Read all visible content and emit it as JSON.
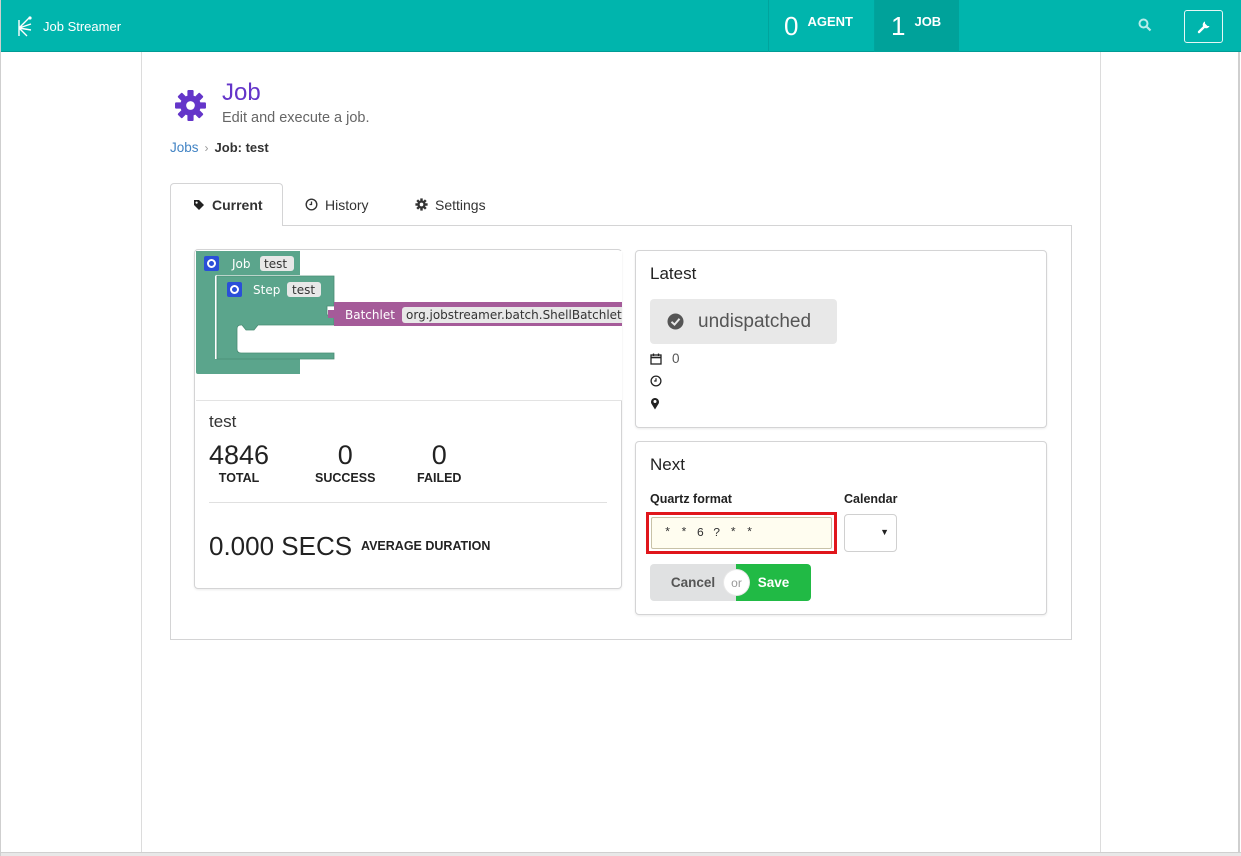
{
  "navbar": {
    "app_name": "Job Streamer",
    "agent_count": "0",
    "agent_label": "AGENT",
    "job_count": "1",
    "job_label": "JOB",
    "icons": [
      "logo-icon",
      "search-icon",
      "wrench-icon"
    ],
    "color": "#00b5ad"
  },
  "header": {
    "title": "Job",
    "subtitle": "Edit and execute a job.",
    "icon": "gear-icon",
    "color": "#6435c9"
  },
  "breadcrumb": {
    "root": "Jobs",
    "current": "Job: test"
  },
  "tabs": [
    {
      "label": "Current",
      "icon": "tag-icon",
      "active": true
    },
    {
      "label": "History",
      "icon": "clock-icon",
      "active": false
    },
    {
      "label": "Settings",
      "icon": "gear-icon",
      "active": false
    }
  ],
  "blocks": {
    "job_label": "Job",
    "job_value": "test",
    "step_label": "Step",
    "step_value": "test",
    "batchlet_label": "Batchlet",
    "batchlet_value": "org.jobstreamer.batch.ShellBatchlet",
    "colors": {
      "job": "#5ba58c",
      "batchlet": "#a55b99"
    }
  },
  "summary": {
    "job_name": "test",
    "total_value": "4846",
    "total_label": "TOTAL",
    "success_value": "0",
    "success_label": "SUCCESS",
    "failed_value": "0",
    "failed_label": "FAILED",
    "avg_value": "0.000 SECS",
    "avg_label": "AVERAGE DURATION"
  },
  "latest": {
    "title": "Latest",
    "status": "undispatched",
    "status_icon": "check-circle-icon",
    "date_value": "0",
    "icons": [
      "calendar-icon",
      "clock-icon",
      "map-marker-icon"
    ]
  },
  "next": {
    "title": "Next",
    "quartz_label": "Quartz format",
    "quartz_value": "* * 6 ? * *",
    "calendar_label": "Calendar",
    "calendar_value": "",
    "cancel_label": "Cancel",
    "or_label": "or",
    "save_label": "Save",
    "save_color": "#21ba45",
    "highlight_color": "#e0161b"
  }
}
